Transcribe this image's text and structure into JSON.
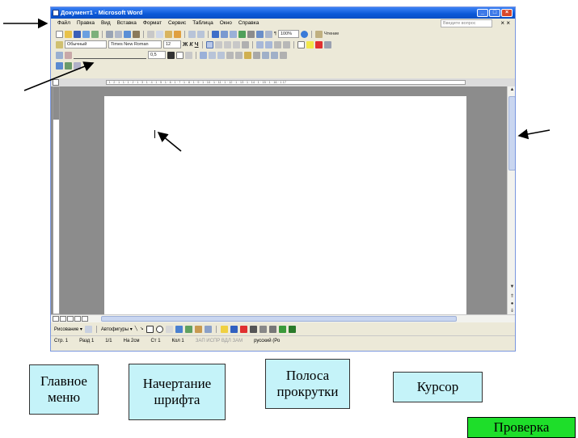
{
  "window": {
    "title": "Документ1 - Microsoft Word",
    "help_placeholder": "Введите вопрос",
    "doc_close": "× ×"
  },
  "menu": [
    "Файл",
    "Правка",
    "Вид",
    "Вставка",
    "Формат",
    "Сервис",
    "Таблица",
    "Окно",
    "Справка"
  ],
  "toolbar_standard": {
    "zoom": "100%",
    "reading": "Чтение"
  },
  "toolbar_formatting": {
    "style": "Обычный",
    "font": "Times New Roman",
    "size": "12",
    "bold": "Ж",
    "italic": "К",
    "underline": "Ч"
  },
  "toolbar_drawing_lines": {
    "line_width": "0,5"
  },
  "ruler_scale": "· 1 · 2 · 1 · 1 · 1 · 2 · 1 · 3 · 1 · 4 · 1 · 5 · 1 · 6 · 1 · 7 · 1 · 8 · 1 · 9 · 1 · 10 · 1 · 11 · 1 · 12 · 1 · 13 · 1 · 14 · 1 · 15 · 1 · 16 · 1 17",
  "drawbar": {
    "draw": "Рисование ▾",
    "autoshapes": "Автофигуры ▾"
  },
  "status": {
    "page": "Стр. 1",
    "section": "Разд 1",
    "pages": "1/1",
    "at": "На 2см",
    "line": "Ст 1",
    "col": "Кол 1",
    "modes": "ЗАП  ИСПР  ВДЛ  ЗАМ",
    "lang": "русский (Ро"
  },
  "quiz_options": [
    "Главное меню",
    "Начертание шрифта",
    "Полоса прокрутки",
    "Курсор"
  ],
  "check_button": "Проверка",
  "colors": {
    "accent": "#0a58d8",
    "option_bg": "#c5f3f9",
    "check_bg": "#1ede2a"
  }
}
